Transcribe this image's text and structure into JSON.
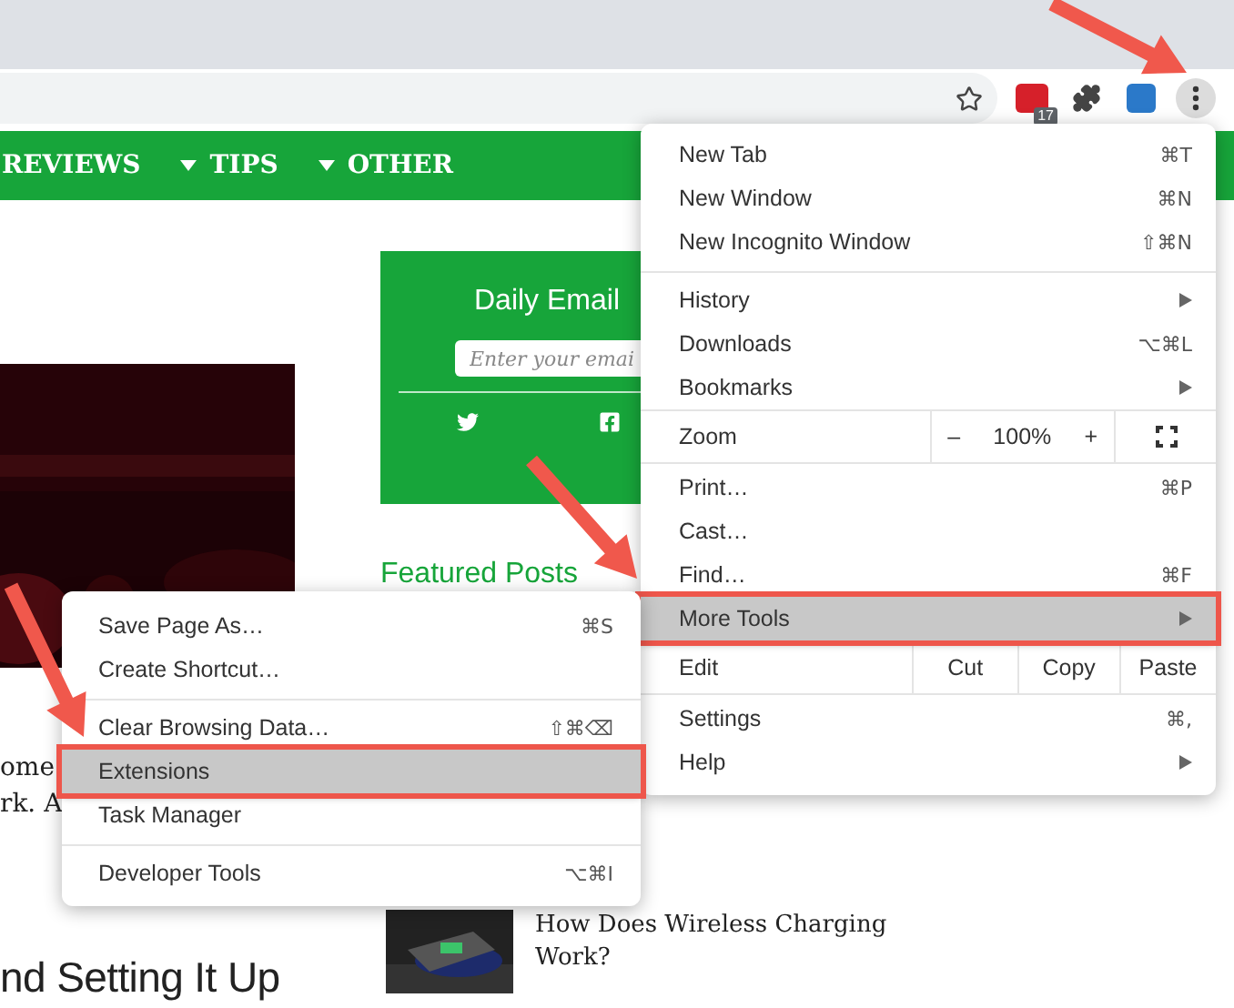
{
  "toolbar": {
    "extension_badge": "17"
  },
  "nav": {
    "items": [
      {
        "label": "REVIEWS",
        "dropdown": false
      },
      {
        "label": "TIPS",
        "dropdown": true
      },
      {
        "label": "OTHER",
        "dropdown": true
      }
    ]
  },
  "newsletter": {
    "title": "Daily Email",
    "placeholder": "Enter your emai"
  },
  "featured": {
    "heading": "Featured Posts",
    "post_title": "How Does Wireless Charging Work?"
  },
  "article": {
    "fragments": [
      "ome",
      "rk. A"
    ],
    "heading": "nd Setting It Up"
  },
  "menu": {
    "items": [
      {
        "kind": "item",
        "label": "New Tab",
        "shortcut": "⌘T",
        "has_submenu": false,
        "selected": false
      },
      {
        "kind": "item",
        "label": "New Window",
        "shortcut": "⌘N",
        "has_submenu": false,
        "selected": false
      },
      {
        "kind": "item",
        "label": "New Incognito Window",
        "shortcut": "⇧⌘N",
        "has_submenu": false,
        "selected": false
      },
      {
        "kind": "separator"
      },
      {
        "kind": "item",
        "label": "History",
        "has_submenu": true,
        "selected": false
      },
      {
        "kind": "item",
        "label": "Downloads",
        "shortcut": "⌥⌘L",
        "has_submenu": false,
        "selected": false
      },
      {
        "kind": "item",
        "label": "Bookmarks",
        "has_submenu": true,
        "selected": false
      },
      {
        "kind": "zoom",
        "label": "Zoom",
        "minus": "–",
        "value": "100%",
        "plus": "+"
      },
      {
        "kind": "item",
        "label": "Print…",
        "shortcut": "⌘P",
        "has_submenu": false,
        "selected": false
      },
      {
        "kind": "item",
        "label": "Cast…",
        "has_submenu": false,
        "selected": false
      },
      {
        "kind": "item",
        "label": "Find…",
        "shortcut": "⌘F",
        "has_submenu": false,
        "selected": false
      },
      {
        "kind": "item",
        "label": "More Tools",
        "has_submenu": true,
        "selected": true
      },
      {
        "kind": "edit",
        "label": "Edit",
        "actions": [
          "Cut",
          "Copy",
          "Paste"
        ]
      },
      {
        "kind": "item",
        "label": "Settings",
        "shortcut": "⌘,",
        "has_submenu": false,
        "selected": false
      },
      {
        "kind": "item",
        "label": "Help",
        "has_submenu": true,
        "selected": false
      }
    ]
  },
  "submenu": {
    "items": [
      {
        "kind": "item",
        "label": "Save Page As…",
        "shortcut": "⌘S",
        "has_submenu": false,
        "selected": false
      },
      {
        "kind": "item",
        "label": "Create Shortcut…",
        "has_submenu": false,
        "selected": false
      },
      {
        "kind": "separator"
      },
      {
        "kind": "item",
        "label": "Clear Browsing Data…",
        "shortcut": "⇧⌘⌫",
        "has_submenu": false,
        "selected": false
      },
      {
        "kind": "item",
        "label": "Extensions",
        "has_submenu": false,
        "selected": true
      },
      {
        "kind": "item",
        "label": "Task Manager",
        "has_submenu": false,
        "selected": false
      },
      {
        "kind": "separator"
      },
      {
        "kind": "item",
        "label": "Developer Tools",
        "shortcut": "⌥⌘I",
        "has_submenu": false,
        "selected": false
      }
    ]
  }
}
